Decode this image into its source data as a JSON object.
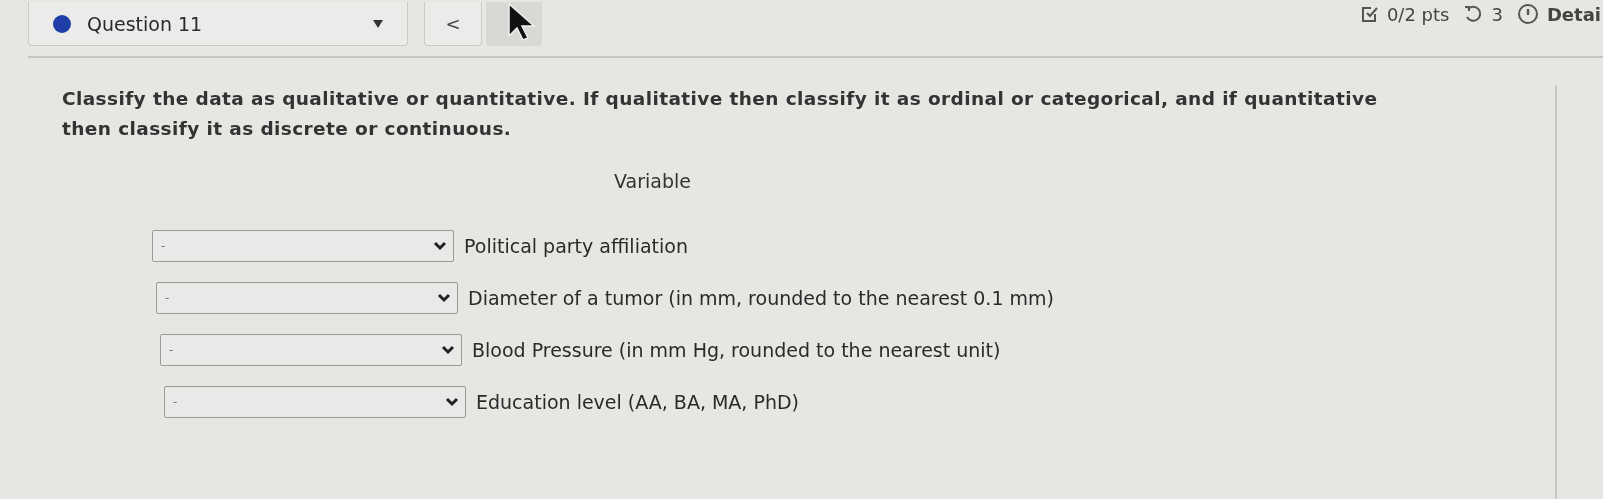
{
  "question_selector": {
    "label": "Question 11",
    "color": "#1f3fa8"
  },
  "nav": {
    "prev": "<"
  },
  "score": {
    "points": "0/2 pts",
    "attempts": "3",
    "details": "Detai"
  },
  "prompt": "Classify the data as qualitative or quantitative. If qualitative then classify it as ordinal or categorical, and if quantitative then classify it as discrete or continuous.",
  "table": {
    "header": "Variable",
    "rows": [
      {
        "answer": "-",
        "variable": "Political party affiliation"
      },
      {
        "answer": "-",
        "variable": "Diameter of a tumor (in mm, rounded to the nearest 0.1 mm)"
      },
      {
        "answer": "-",
        "variable": "Blood Pressure (in mm Hg, rounded to the nearest unit)"
      },
      {
        "answer": "-",
        "variable": "Education level (AA, BA, MA, PhD)"
      }
    ]
  }
}
